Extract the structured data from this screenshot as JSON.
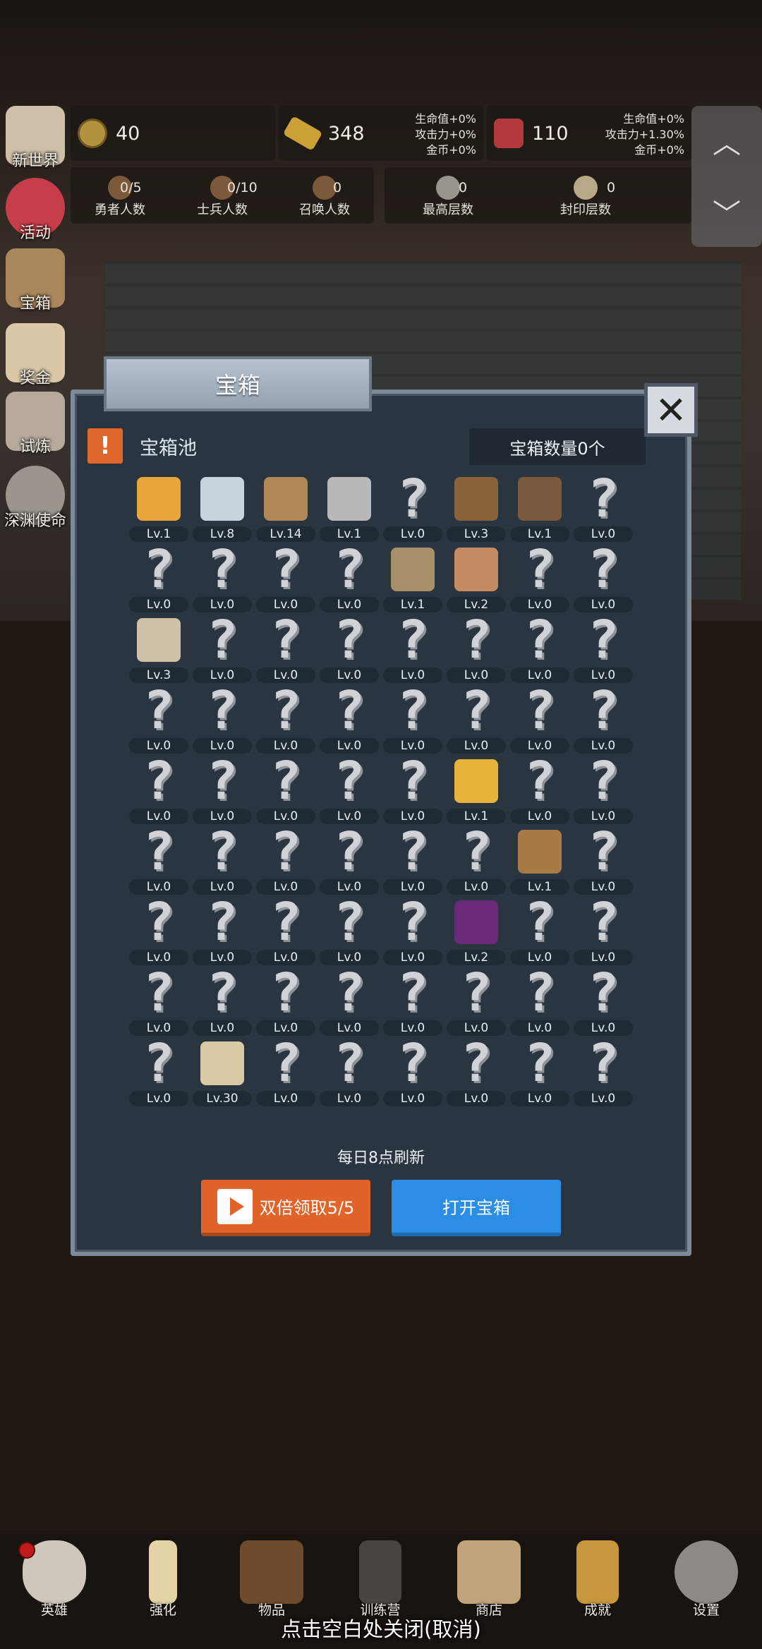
{
  "resources": {
    "coin": {
      "value": "40"
    },
    "gold_bar": {
      "value": "348",
      "bonus": [
        "生命值+0%",
        "攻击力+0%",
        "金币+0%"
      ]
    },
    "meat": {
      "value": "110",
      "bonus": [
        "生命值+0%",
        "攻击力+1.30%",
        "金币+0%"
      ]
    }
  },
  "counts": [
    {
      "label": "勇者人数",
      "value": "0/5"
    },
    {
      "label": "士兵人数",
      "value": "0/10"
    },
    {
      "label": "召唤人数",
      "value": "0"
    },
    {
      "label": "最高层数",
      "value": "0"
    },
    {
      "label": "封印层数",
      "value": "0"
    }
  ],
  "side_menu": [
    "新世界",
    "活动",
    "宝箱",
    "奖金",
    "试炼",
    "深渊使命"
  ],
  "modal": {
    "title": "宝箱",
    "pool_title": "宝箱池",
    "warn_glyph": "!",
    "close_glyph": "✕",
    "chest_count": "宝箱数量0个",
    "refresh_note": "每日8点刷新",
    "double_button": "双倍领取5/5",
    "open_button": "打开宝箱"
  },
  "items": [
    [
      "Lv.1",
      "Lv.8",
      "Lv.14",
      "Lv.1",
      "Lv.0",
      "Lv.3",
      "Lv.1",
      "Lv.0"
    ],
    [
      "Lv.0",
      "Lv.0",
      "Lv.0",
      "Lv.0",
      "Lv.1",
      "Lv.2",
      "Lv.0",
      "Lv.0"
    ],
    [
      "Lv.3",
      "Lv.0",
      "Lv.0",
      "Lv.0",
      "Lv.0",
      "Lv.0",
      "Lv.0",
      "Lv.0"
    ],
    [
      "Lv.0",
      "Lv.0",
      "Lv.0",
      "Lv.0",
      "Lv.0",
      "Lv.0",
      "Lv.0",
      "Lv.0"
    ],
    [
      "Lv.0",
      "Lv.0",
      "Lv.0",
      "Lv.0",
      "Lv.0",
      "Lv.1",
      "Lv.0",
      "Lv.0"
    ],
    [
      "Lv.0",
      "Lv.0",
      "Lv.0",
      "Lv.0",
      "Lv.0",
      "Lv.0",
      "Lv.1",
      "Lv.0"
    ],
    [
      "Lv.0",
      "Lv.0",
      "Lv.0",
      "Lv.0",
      "Lv.0",
      "Lv.2",
      "Lv.0",
      "Lv.0"
    ],
    [
      "Lv.0",
      "Lv.0",
      "Lv.0",
      "Lv.0",
      "Lv.0",
      "Lv.0",
      "Lv.0",
      "Lv.0"
    ],
    [
      "Lv.0",
      "Lv.30",
      "Lv.0",
      "Lv.0",
      "Lv.0",
      "Lv.0",
      "Lv.0",
      "Lv.0"
    ]
  ],
  "unlocked_icons": {
    "0-0": {
      "name": "crown-icon",
      "color": "#e8a53a"
    },
    "0-1": {
      "name": "diamond-icon",
      "color": "#c9d3dc"
    },
    "0-2": {
      "name": "wooden-sword-icon",
      "color": "#b08857"
    },
    "0-3": {
      "name": "iron-sword-icon",
      "color": "#b9b9b9"
    },
    "0-5": {
      "name": "leather-armor-icon",
      "color": "#8a6239"
    },
    "0-6": {
      "name": "backpack-icon",
      "color": "#7a5a3c"
    },
    "1-4": {
      "name": "knight-helmet-icon",
      "color": "#a8916a"
    },
    "1-5": {
      "name": "ham-icon",
      "color": "#c58b62"
    },
    "2-0": {
      "name": "bread-bowl-icon",
      "color": "#cfc1a8"
    },
    "4-5": {
      "name": "torch-icon",
      "color": "#e8b33a"
    },
    "5-6": {
      "name": "satchel-icon",
      "color": "#a87a46"
    },
    "6-5": {
      "name": "dark-crystal-icon",
      "color": "#6a2a7a"
    },
    "8-1": {
      "name": "beer-mug-icon",
      "color": "#d9c9a4"
    }
  },
  "question_glyph": "?",
  "bottom_nav": [
    "英雄",
    "强化",
    "物品",
    "训练营",
    "商店",
    "成就",
    "设置"
  ],
  "close_hint": "点击空白处关闭(取消)",
  "arrows": {
    "up": "︿",
    "down": "﹀"
  }
}
